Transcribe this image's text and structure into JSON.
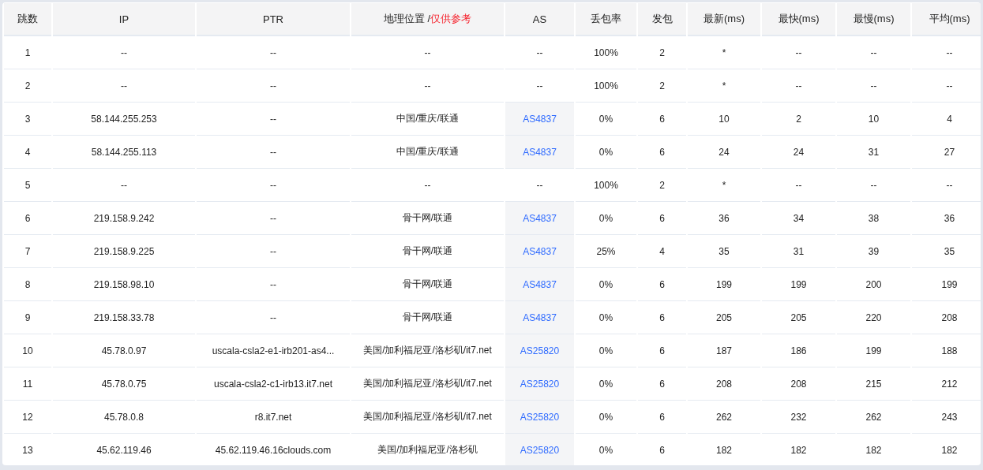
{
  "columns": [
    {
      "label": "跳数"
    },
    {
      "label": "IP"
    },
    {
      "label": "PTR"
    },
    {
      "label": "地理位置 /",
      "note": "仅供参考"
    },
    {
      "label": "AS"
    },
    {
      "label": "丢包率"
    },
    {
      "label": "发包"
    },
    {
      "label": "最新(ms)"
    },
    {
      "label": "最快(ms)"
    },
    {
      "label": "最慢(ms)"
    },
    {
      "label": "平均(ms)"
    }
  ],
  "rows": [
    {
      "hop": "1",
      "ip": "--",
      "ptr": "--",
      "geo": "--",
      "as": "--",
      "as_link": false,
      "loss": "100%",
      "sent": "2",
      "last": "*",
      "best": "--",
      "worst": "--",
      "avg": "--"
    },
    {
      "hop": "2",
      "ip": "--",
      "ptr": "--",
      "geo": "--",
      "as": "--",
      "as_link": false,
      "loss": "100%",
      "sent": "2",
      "last": "*",
      "best": "--",
      "worst": "--",
      "avg": "--"
    },
    {
      "hop": "3",
      "ip": "58.144.255.253",
      "ptr": "--",
      "geo": "中国/重庆/联通",
      "as": "AS4837",
      "as_link": true,
      "loss": "0%",
      "sent": "6",
      "last": "10",
      "best": "2",
      "worst": "10",
      "avg": "4"
    },
    {
      "hop": "4",
      "ip": "58.144.255.113",
      "ptr": "--",
      "geo": "中国/重庆/联通",
      "as": "AS4837",
      "as_link": true,
      "loss": "0%",
      "sent": "6",
      "last": "24",
      "best": "24",
      "worst": "31",
      "avg": "27"
    },
    {
      "hop": "5",
      "ip": "--",
      "ptr": "--",
      "geo": "--",
      "as": "--",
      "as_link": false,
      "loss": "100%",
      "sent": "2",
      "last": "*",
      "best": "--",
      "worst": "--",
      "avg": "--"
    },
    {
      "hop": "6",
      "ip": "219.158.9.242",
      "ptr": "--",
      "geo": "骨干网/联通",
      "as": "AS4837",
      "as_link": true,
      "loss": "0%",
      "sent": "6",
      "last": "36",
      "best": "34",
      "worst": "38",
      "avg": "36"
    },
    {
      "hop": "7",
      "ip": "219.158.9.225",
      "ptr": "--",
      "geo": "骨干网/联通",
      "as": "AS4837",
      "as_link": true,
      "loss": "25%",
      "sent": "4",
      "last": "35",
      "best": "31",
      "worst": "39",
      "avg": "35"
    },
    {
      "hop": "8",
      "ip": "219.158.98.10",
      "ptr": "--",
      "geo": "骨干网/联通",
      "as": "AS4837",
      "as_link": true,
      "loss": "0%",
      "sent": "6",
      "last": "199",
      "best": "199",
      "worst": "200",
      "avg": "199"
    },
    {
      "hop": "9",
      "ip": "219.158.33.78",
      "ptr": "--",
      "geo": "骨干网/联通",
      "as": "AS4837",
      "as_link": true,
      "loss": "0%",
      "sent": "6",
      "last": "205",
      "best": "205",
      "worst": "220",
      "avg": "208"
    },
    {
      "hop": "10",
      "ip": "45.78.0.97",
      "ptr": "uscala-csla2-e1-irb201-as4...",
      "geo": "美国/加利福尼亚/洛杉矶/it7.net",
      "as": "AS25820",
      "as_link": true,
      "loss": "0%",
      "sent": "6",
      "last": "187",
      "best": "186",
      "worst": "199",
      "avg": "188"
    },
    {
      "hop": "11",
      "ip": "45.78.0.75",
      "ptr": "uscala-csla2-c1-irb13.it7.net",
      "geo": "美国/加利福尼亚/洛杉矶/it7.net",
      "as": "AS25820",
      "as_link": true,
      "loss": "0%",
      "sent": "6",
      "last": "208",
      "best": "208",
      "worst": "215",
      "avg": "212"
    },
    {
      "hop": "12",
      "ip": "45.78.0.8",
      "ptr": "r8.it7.net",
      "geo": "美国/加利福尼亚/洛杉矶/it7.net",
      "as": "AS25820",
      "as_link": true,
      "loss": "0%",
      "sent": "6",
      "last": "262",
      "best": "232",
      "worst": "262",
      "avg": "243"
    },
    {
      "hop": "13",
      "ip": "45.62.119.46",
      "ptr": "45.62.119.46.16clouds.com",
      "geo": "美国/加利福尼亚/洛杉矶",
      "as": "AS25820",
      "as_link": true,
      "loss": "0%",
      "sent": "6",
      "last": "182",
      "best": "182",
      "worst": "182",
      "avg": "182"
    }
  ]
}
